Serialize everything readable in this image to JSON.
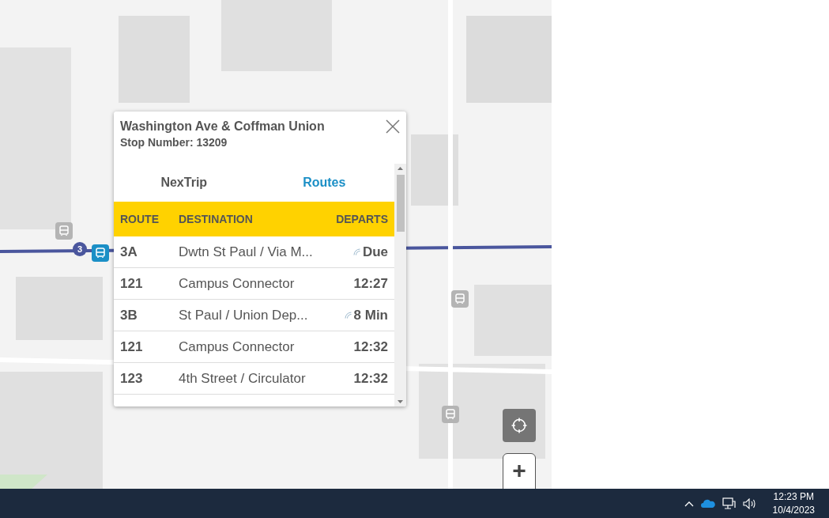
{
  "map": {
    "stop_markers": [
      {
        "selected": false
      },
      {
        "selected": true,
        "badge": "3"
      },
      {
        "selected": false
      },
      {
        "selected": false
      }
    ],
    "controls": {
      "zoom_in": "+"
    }
  },
  "popup": {
    "title": "Washington Ave & Coffman Union",
    "subtitle": "Stop Number: 13209",
    "tabs": [
      {
        "label": "NexTrip",
        "selected": false
      },
      {
        "label": "Routes",
        "selected": true
      }
    ],
    "table": {
      "columns": [
        "ROUTE",
        "DESTINATION",
        "DEPARTS"
      ],
      "rows": [
        {
          "route": "3A",
          "destination": "Dwtn St Paul / Via M...",
          "departs": "Due",
          "realtime": true
        },
        {
          "route": "121",
          "destination": "Campus Connector",
          "departs": "12:27",
          "realtime": false
        },
        {
          "route": "3B",
          "destination": "St Paul / Union Dep...",
          "departs": "8 Min",
          "realtime": true
        },
        {
          "route": "121",
          "destination": "Campus Connector",
          "departs": "12:32",
          "realtime": false
        },
        {
          "route": "123",
          "destination": "4th Street / Circulator",
          "departs": "12:32",
          "realtime": false
        }
      ]
    }
  },
  "taskbar": {
    "time": "12:23 PM",
    "date": "10/4/2023"
  }
}
